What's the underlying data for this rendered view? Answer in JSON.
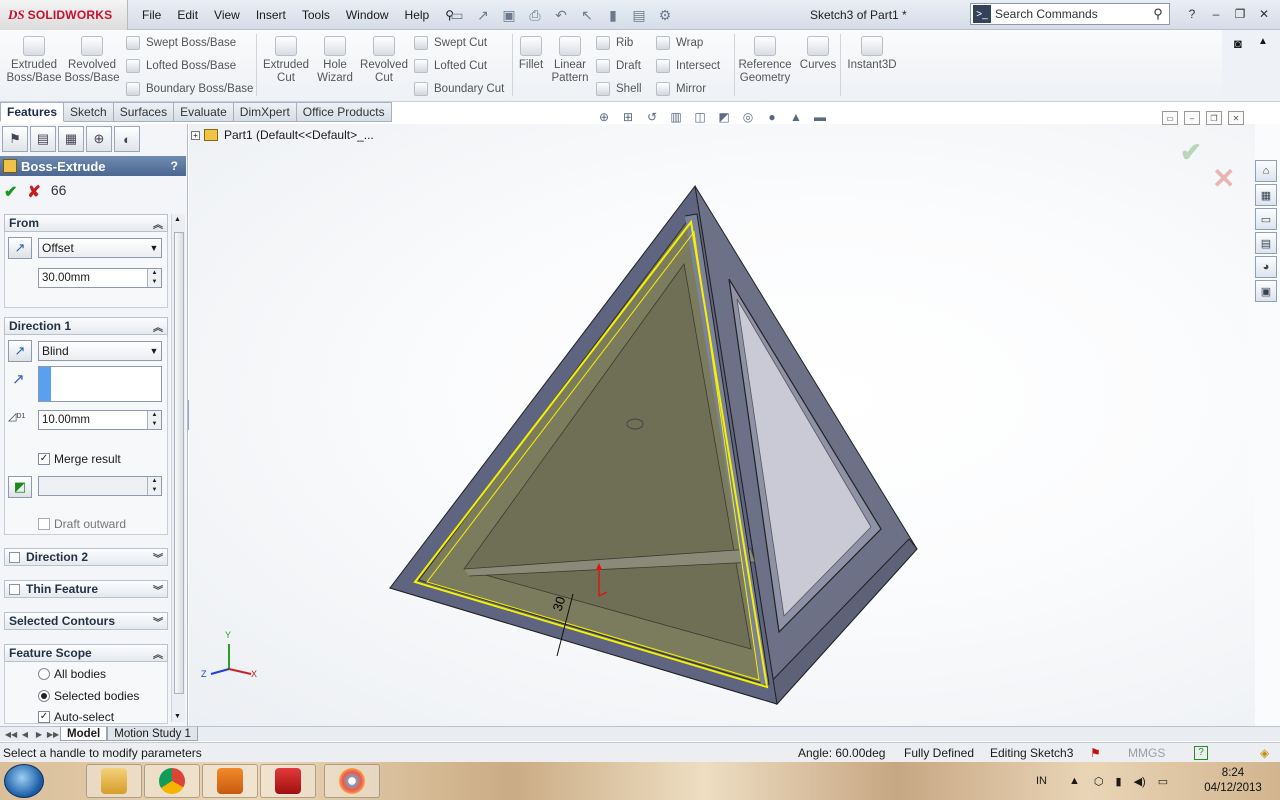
{
  "app": {
    "brand": "SOLIDWORKS",
    "document_title": "Sketch3 of Part1 *",
    "menus": [
      "File",
      "Edit",
      "View",
      "Insert",
      "Tools",
      "Window",
      "Help"
    ],
    "search_placeholder": "Search Commands",
    "help_label": "?"
  },
  "command_manager": {
    "extruded_boss": "Extruded Boss/Base",
    "revolved_boss": "Revolved Boss/Base",
    "swept_boss": "Swept Boss/Base",
    "lofted_boss": "Lofted Boss/Base",
    "boundary_boss": "Boundary Boss/Base",
    "extruded_cut": "Extruded Cut",
    "hole_wizard": "Hole Wizard",
    "revolved_cut": "Revolved Cut",
    "swept_cut": "Swept Cut",
    "lofted_cut": "Lofted Cut",
    "boundary_cut": "Boundary Cut",
    "fillet": "Fillet",
    "linear_pattern": "Linear Pattern",
    "rib": "Rib",
    "draft": "Draft",
    "shell": "Shell",
    "wrap": "Wrap",
    "intersect": "Intersect",
    "mirror": "Mirror",
    "reference_geometry": "Reference Geometry",
    "curves": "Curves",
    "instant3d": "Instant3D"
  },
  "tabs": [
    "Features",
    "Sketch",
    "Surfaces",
    "Evaluate",
    "DimXpert",
    "Office Products"
  ],
  "property_manager": {
    "title": "Boss-Extrude",
    "help": "?",
    "from": {
      "header": "From",
      "type": "Offset",
      "offset_value": "30.00mm"
    },
    "direction1": {
      "header": "Direction 1",
      "end_condition": "Blind",
      "depth": "10.00mm",
      "depth_label": "D1",
      "merge_result": "Merge result",
      "draft_outward": "Draft outward"
    },
    "direction2": {
      "header": "Direction 2"
    },
    "thin_feature": {
      "header": "Thin Feature"
    },
    "selected_contours": {
      "header": "Selected Contours"
    },
    "feature_scope": {
      "header": "Feature Scope",
      "all_bodies": "All bodies",
      "selected_bodies": "Selected bodies",
      "auto_select": "Auto-select"
    }
  },
  "graphics": {
    "tree_label": "Part1  (Default<<Default>_...",
    "dimension_label": "30",
    "triad": {
      "x": "X",
      "y": "Y",
      "z": "Z"
    }
  },
  "bottom_tabs": [
    "Model",
    "Motion Study 1"
  ],
  "status": {
    "message": "Select a handle to modify parameters",
    "angle": "Angle: 60.00deg",
    "definition": "Fully Defined",
    "editing": "Editing Sketch3",
    "units": "MMGS",
    "help": "?"
  },
  "taskbar": {
    "language": "IN",
    "time": "8:24",
    "date": "04/12/2013"
  },
  "colors": {
    "accent_title": "#4b6791",
    "model_face": "#7b7c5e",
    "model_edge": "#5c6277",
    "highlight": "#f5f100"
  }
}
